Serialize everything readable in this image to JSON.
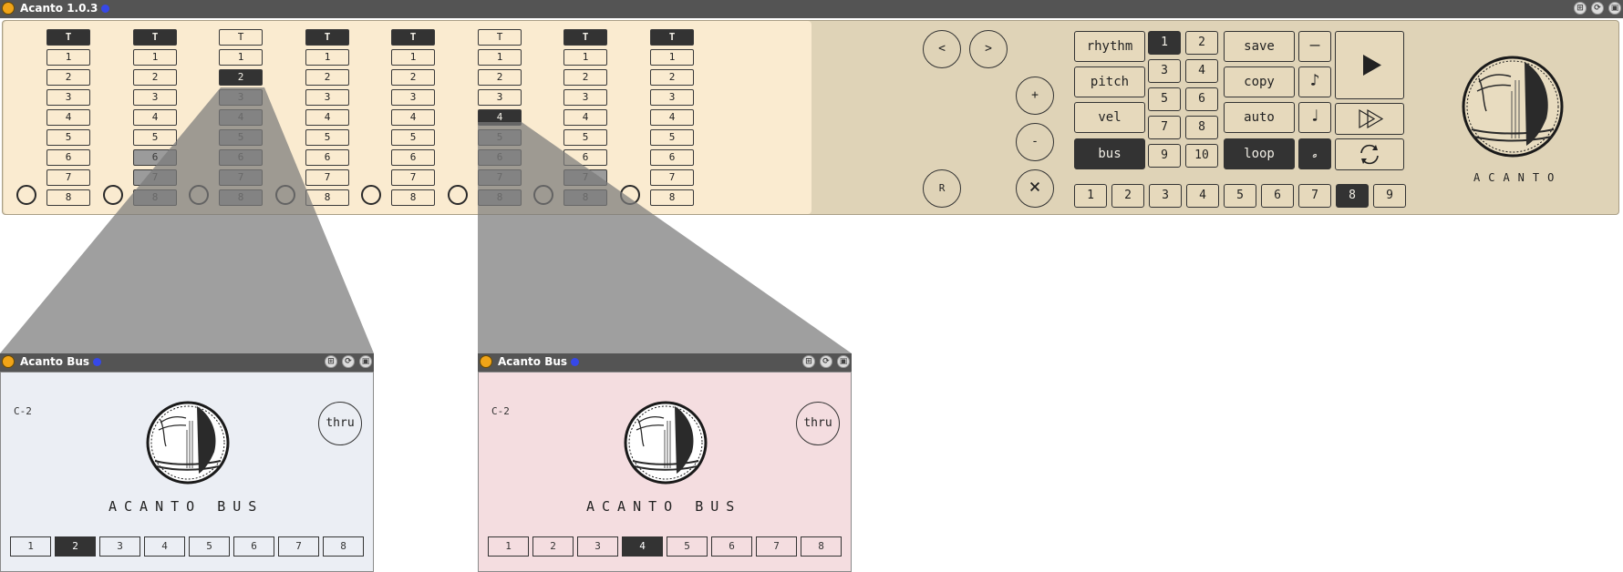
{
  "main_window": {
    "title": "Acanto 1.0.3",
    "window_buttons": [
      "⊞",
      "⟳",
      "▣"
    ]
  },
  "sequencer": {
    "header_label": "T",
    "step_labels": [
      "1",
      "2",
      "3",
      "4",
      "5",
      "6",
      "7",
      "8"
    ],
    "columns": [
      {
        "header_active": true,
        "selected_step": null,
        "greyed_from": null
      },
      {
        "header_active": true,
        "selected_step": null,
        "greyed_from": 6
      },
      {
        "header_active": false,
        "selected_step": 2,
        "greyed_from": 3
      },
      {
        "header_active": true,
        "selected_step": null,
        "greyed_from": null
      },
      {
        "header_active": true,
        "selected_step": null,
        "greyed_from": null
      },
      {
        "header_active": false,
        "selected_step": 4,
        "greyed_from": 5
      },
      {
        "header_active": true,
        "selected_step": null,
        "greyed_from": 7
      },
      {
        "header_active": true,
        "selected_step": null,
        "greyed_from": null
      }
    ]
  },
  "transport": {
    "prev": "<",
    "next": ">",
    "plus": "+",
    "minus": "-",
    "reset": "R",
    "clear": "×"
  },
  "modes": {
    "buttons": [
      {
        "label": "rhythm",
        "active": false
      },
      {
        "label": "pitch",
        "active": false
      },
      {
        "label": "vel",
        "active": false
      },
      {
        "label": "bus",
        "active": true
      }
    ]
  },
  "numgrid": {
    "buttons": [
      {
        "label": "1",
        "active": true
      },
      {
        "label": "2",
        "active": false
      },
      {
        "label": "3",
        "active": false
      },
      {
        "label": "4",
        "active": false
      },
      {
        "label": "5",
        "active": false
      },
      {
        "label": "6",
        "active": false
      },
      {
        "label": "7",
        "active": false
      },
      {
        "label": "8",
        "active": false
      },
      {
        "label": "9",
        "active": false
      },
      {
        "label": "10",
        "active": false
      }
    ]
  },
  "actions": {
    "buttons": [
      {
        "label": "save",
        "active": false
      },
      {
        "label": "copy",
        "active": false
      },
      {
        "label": "auto",
        "active": false
      },
      {
        "label": "loop",
        "active": true
      }
    ]
  },
  "notes": {
    "buttons": [
      {
        "icon": "rest-icon",
        "glyph": "—",
        "active": false
      },
      {
        "icon": "eighth-note-icon",
        "glyph": "♪",
        "active": false
      },
      {
        "icon": "quarter-note-icon",
        "glyph": "♩",
        "active": false
      },
      {
        "icon": "half-note-icon",
        "glyph": "𝅗",
        "active": true
      }
    ]
  },
  "playback": {
    "icons": [
      "play-icon",
      "play-step-icon",
      "repeat-icon"
    ]
  },
  "tracks": {
    "labels": [
      "1",
      "2",
      "3",
      "4",
      "5",
      "6",
      "7",
      "8",
      "9"
    ],
    "selected": "8"
  },
  "brand": {
    "name": "ACANTO"
  },
  "bus_windows": [
    {
      "title": "Acanto Bus",
      "note": "C-2",
      "thru_label": "thru",
      "brand": "ACANTO BUS",
      "bg_color": "#ebeef4",
      "buttons": [
        "1",
        "2",
        "3",
        "4",
        "5",
        "6",
        "7",
        "8"
      ],
      "selected": "2"
    },
    {
      "title": "Acanto Bus",
      "note": "C-2",
      "thru_label": "thru",
      "brand": "ACANTO BUS",
      "bg_color": "#f4dde0",
      "buttons": [
        "1",
        "2",
        "3",
        "4",
        "5",
        "6",
        "7",
        "8"
      ],
      "selected": "4"
    }
  ],
  "colors": {
    "seq_bg": "#faebd0",
    "panel_bg": "#dfd3b7",
    "active_dark": "#333333",
    "grey_cell": "#9b9b9b",
    "titlebar": "#545454",
    "title_dot": "#f0a418",
    "title_gem": "#3648e8"
  }
}
